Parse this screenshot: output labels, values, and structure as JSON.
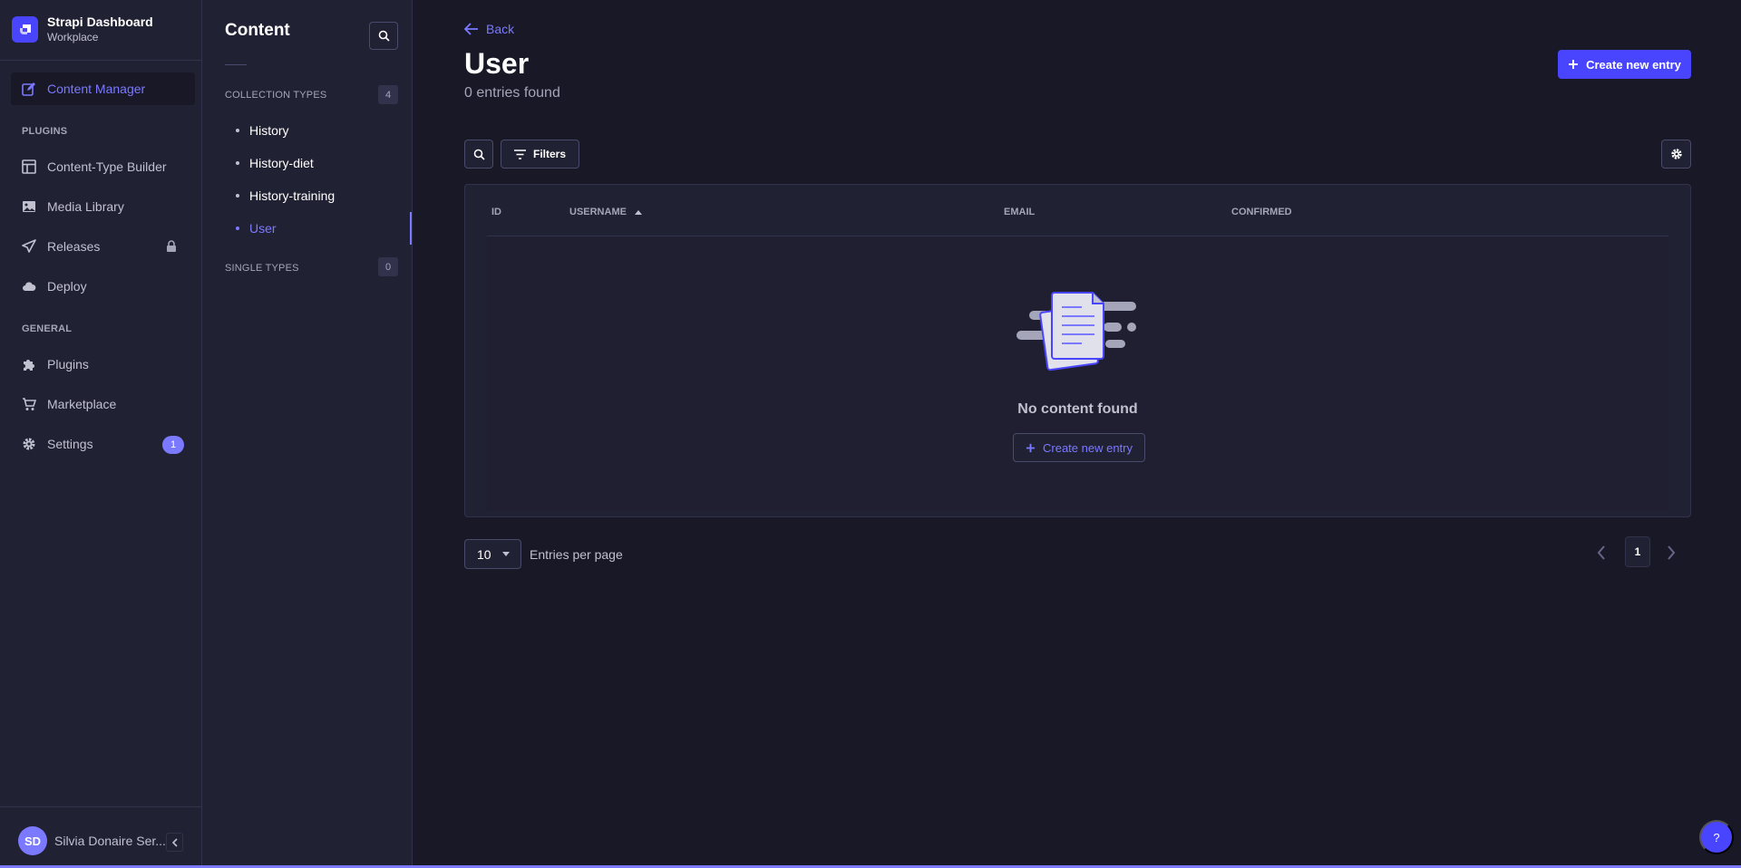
{
  "brand": {
    "title": "Strapi Dashboard",
    "subtitle": "Workplace",
    "logo_icon": "strapi-logo-icon"
  },
  "mainnav": {
    "active_item": {
      "label": "Content Manager",
      "icon": "pencil-icon"
    },
    "sections": [
      {
        "title": "PLUGINS",
        "items": [
          {
            "label": "Content-Type Builder",
            "icon": "layout-icon"
          },
          {
            "label": "Media Library",
            "icon": "image-icon"
          },
          {
            "label": "Releases",
            "icon": "paper-plane-icon",
            "locked": true
          },
          {
            "label": "Deploy",
            "icon": "cloud-icon"
          }
        ]
      },
      {
        "title": "GENERAL",
        "items": [
          {
            "label": "Plugins",
            "icon": "puzzle-icon"
          },
          {
            "label": "Marketplace",
            "icon": "cart-icon"
          },
          {
            "label": "Settings",
            "icon": "gear-icon",
            "badge": "1"
          }
        ]
      }
    ],
    "user": {
      "initials": "SD",
      "name": "Silvia Donaire Ser..."
    }
  },
  "subnav": {
    "title": "Content",
    "collection_types": {
      "label": "COLLECTION TYPES",
      "count": "4",
      "items": [
        "History",
        "History-diet",
        "History-training",
        "User"
      ],
      "active": "User"
    },
    "single_types": {
      "label": "SINGLE TYPES",
      "count": "0"
    }
  },
  "main": {
    "back_label": "Back",
    "title": "User",
    "subtitle": "0 entries found",
    "create_label": "Create new entry",
    "filters_label": "Filters",
    "columns": [
      "ID",
      "USERNAME",
      "EMAIL",
      "CONFIRMED"
    ],
    "sorted_column": "USERNAME",
    "sort_direction": "ascending",
    "empty_text": "No content found",
    "empty_create_label": "Create new entry",
    "per_page_value": "10",
    "per_page_label": "Entries per page",
    "current_page": "1",
    "help_label": "?"
  },
  "colors": {
    "accent": "#7b79ff",
    "primary": "#4945ff",
    "background": "#181826",
    "panel": "#212134",
    "border": "#32324d"
  }
}
